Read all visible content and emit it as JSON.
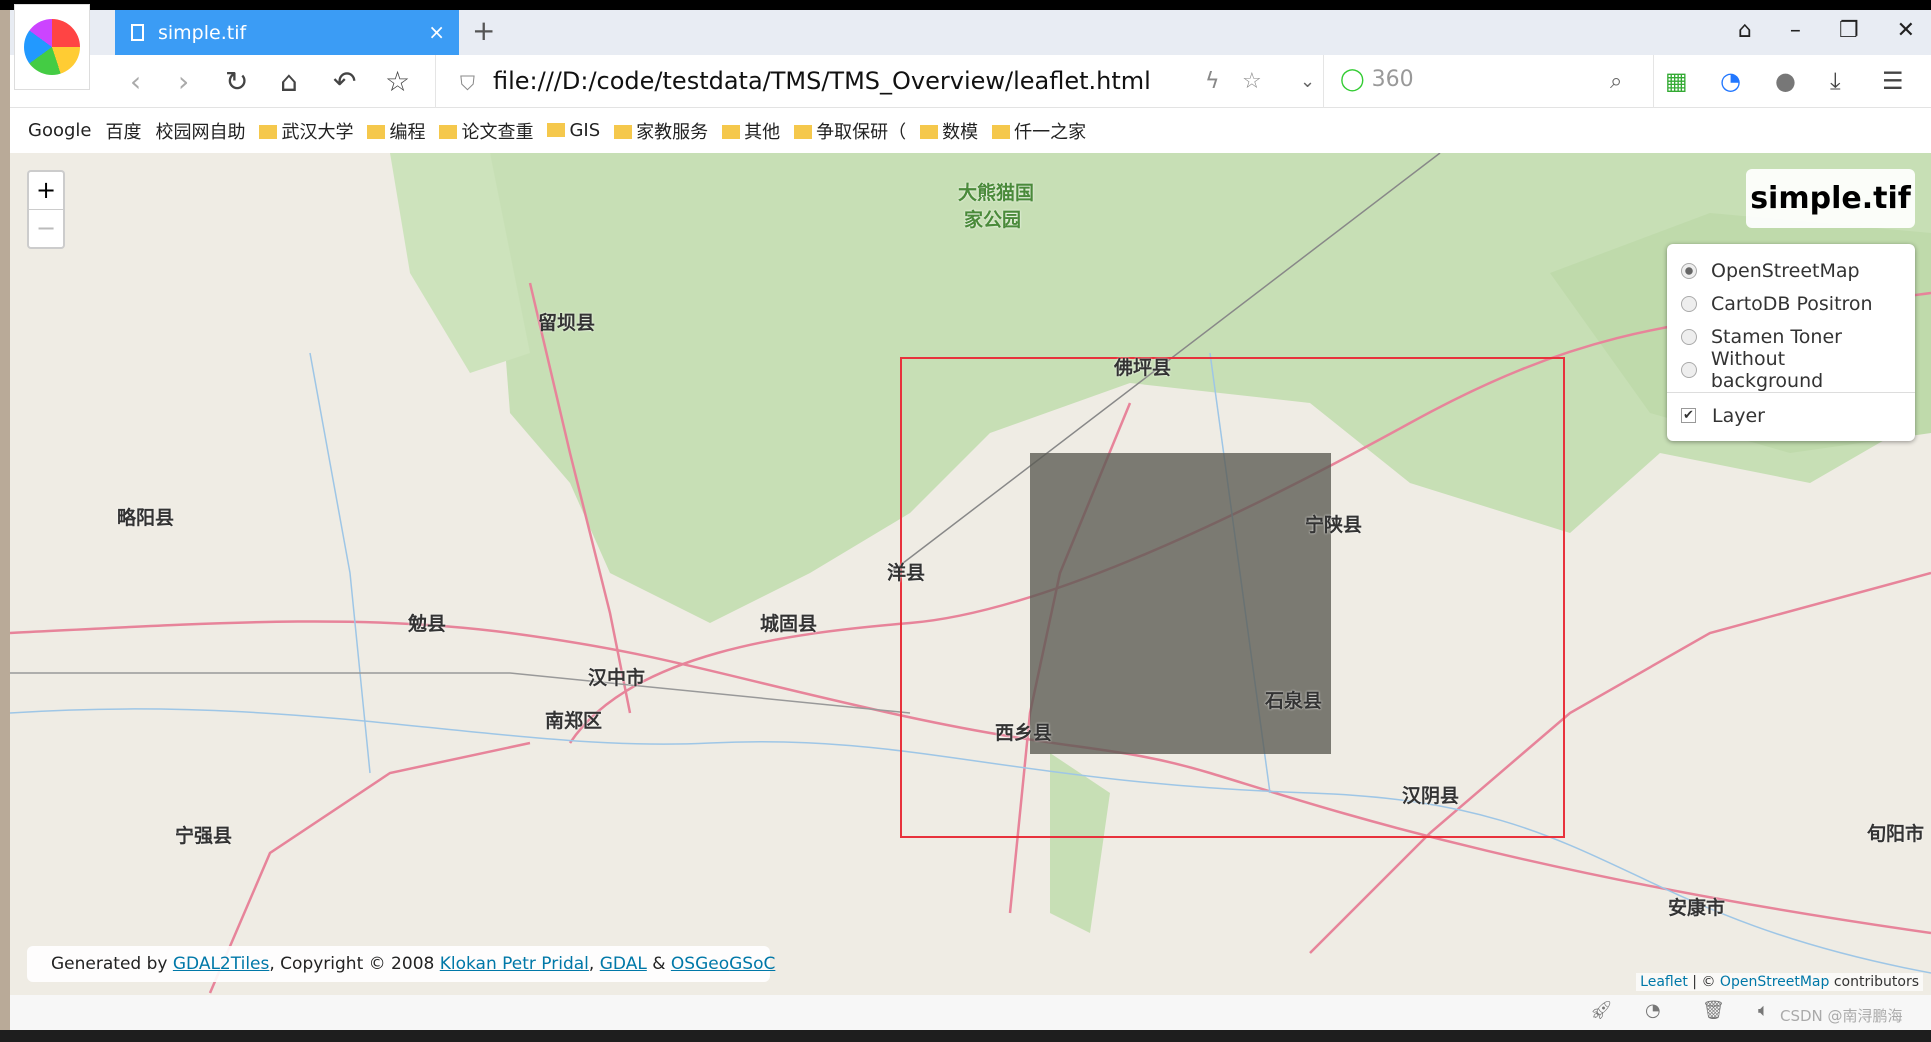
{
  "browser": {
    "tab_title": "simple.tif",
    "close": "×",
    "new_tab": "+",
    "url": "file:///D:/code/testdata/TMS/TMS_Overview/leaflet.html",
    "search_engine": "360",
    "window_buttons": [
      "shirt-icon",
      "minimize-icon",
      "restore-icon",
      "close-icon"
    ],
    "nav_icons": [
      "back-icon",
      "forward-icon",
      "reload-icon",
      "home-icon",
      "undo-icon",
      "star-icon"
    ]
  },
  "bookmarks": [
    {
      "label": "Google",
      "icon": "google-icon"
    },
    {
      "label": "百度",
      "icon": "baidu-icon"
    },
    {
      "label": "校园网自助",
      "icon": "page-icon"
    },
    {
      "label": "武汉大学",
      "icon": "folder-icon"
    },
    {
      "label": "编程",
      "icon": "folder-icon"
    },
    {
      "label": "论文查重",
      "icon": "folder-icon"
    },
    {
      "label": "GIS",
      "icon": "folder-icon"
    },
    {
      "label": "家教服务",
      "icon": "folder-icon"
    },
    {
      "label": "其他",
      "icon": "folder-icon"
    },
    {
      "label": "争取保研（",
      "icon": "folder-icon"
    },
    {
      "label": "数模",
      "icon": "folder-icon"
    },
    {
      "label": "仟一之家",
      "icon": "folder-icon"
    }
  ],
  "map": {
    "zoom_in": "+",
    "zoom_out": "−",
    "title": "simple.tif",
    "base_layers": [
      {
        "label": "OpenStreetMap",
        "selected": true
      },
      {
        "label": "CartoDB Positron",
        "selected": false
      },
      {
        "label": "Stamen Toner",
        "selected": false
      },
      {
        "label": "Without background",
        "selected": false
      }
    ],
    "overlays": [
      {
        "label": "Layer",
        "checked": true
      }
    ],
    "bounds_color": "#e8323c",
    "labels": [
      "大熊猫国",
      "家公园",
      "留坝县",
      "佛坪县",
      "宁陕县",
      "洋县",
      "城固县",
      "汉中市",
      "勉县",
      "南郑区",
      "西乡县",
      "石泉县",
      "汉阴县",
      "安康市",
      "宁强县",
      "略阳县",
      "旬阳市"
    ],
    "attribution": {
      "prefix": "Generated by ",
      "gdal2tiles": "GDAL2Tiles",
      "copyright": ", Copyright © 2008 ",
      "klokan": "Klokan Petr Pridal",
      "comma": ", ",
      "gdal": "GDAL",
      "amp": " & ",
      "osgeo": "OSGeo",
      "gsoc": "GSoC"
    },
    "attribution_right": {
      "leaflet": "Leaflet",
      "sep": " | © ",
      "osm": "OpenStreetMap",
      "suffix": " contributors"
    }
  },
  "watermark": "CSDN @南浔鹏海"
}
